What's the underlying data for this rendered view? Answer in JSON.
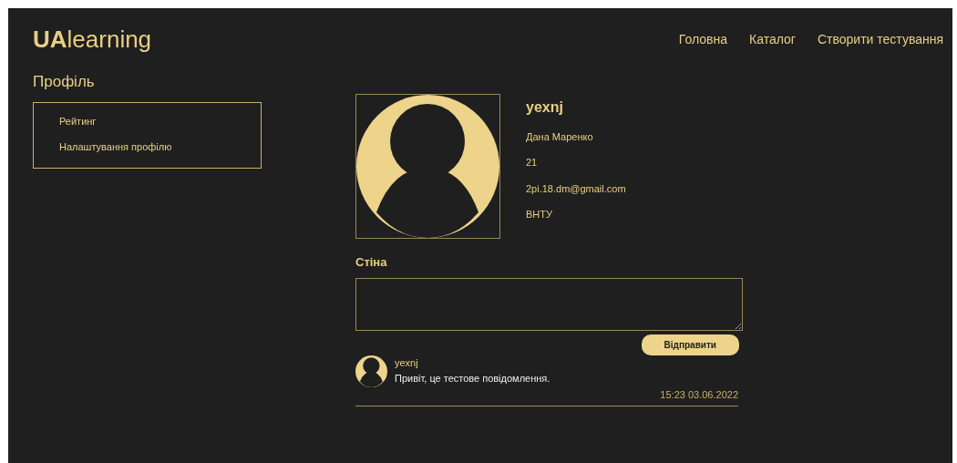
{
  "logo": {
    "bold": "UA",
    "rest": "learning"
  },
  "nav": [
    "Головна",
    "Каталог",
    "Створити тестування"
  ],
  "page_title": "Профіль",
  "sidebar": {
    "items": [
      "Рейтинг",
      "Налаштування профілю"
    ]
  },
  "profile": {
    "username": "yexnj",
    "full_name": "Дана Маренко",
    "age": "21",
    "email": "2pi.18.dm@gmail.com",
    "university": "ВНТУ"
  },
  "wall": {
    "title": "Стіна",
    "send_button": "Відправити",
    "posts": [
      {
        "author": "yexnj",
        "text": "Привіт, це тестове повідомлення.",
        "time": "15:23 03.06.2022"
      }
    ]
  }
}
